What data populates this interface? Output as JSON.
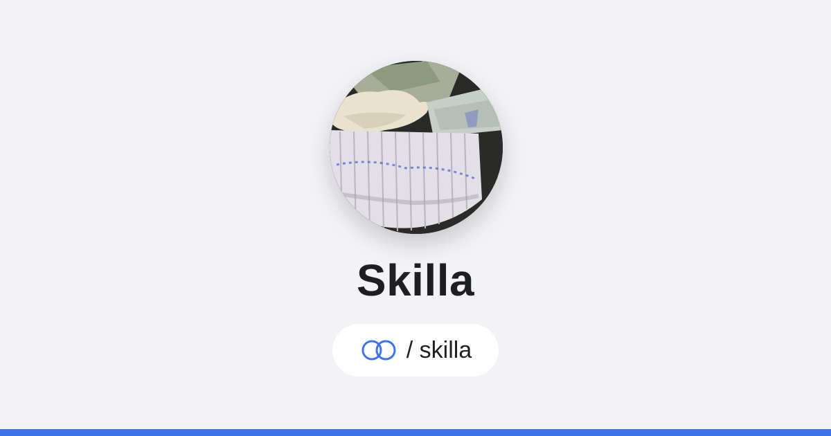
{
  "profile": {
    "display_name": "Skilla",
    "handle": "/ skilla",
    "avatar_description": "photo-avatar"
  },
  "brand": {
    "logo_icon": "linked-rings-icon",
    "accent_color": "#3e74ea"
  }
}
